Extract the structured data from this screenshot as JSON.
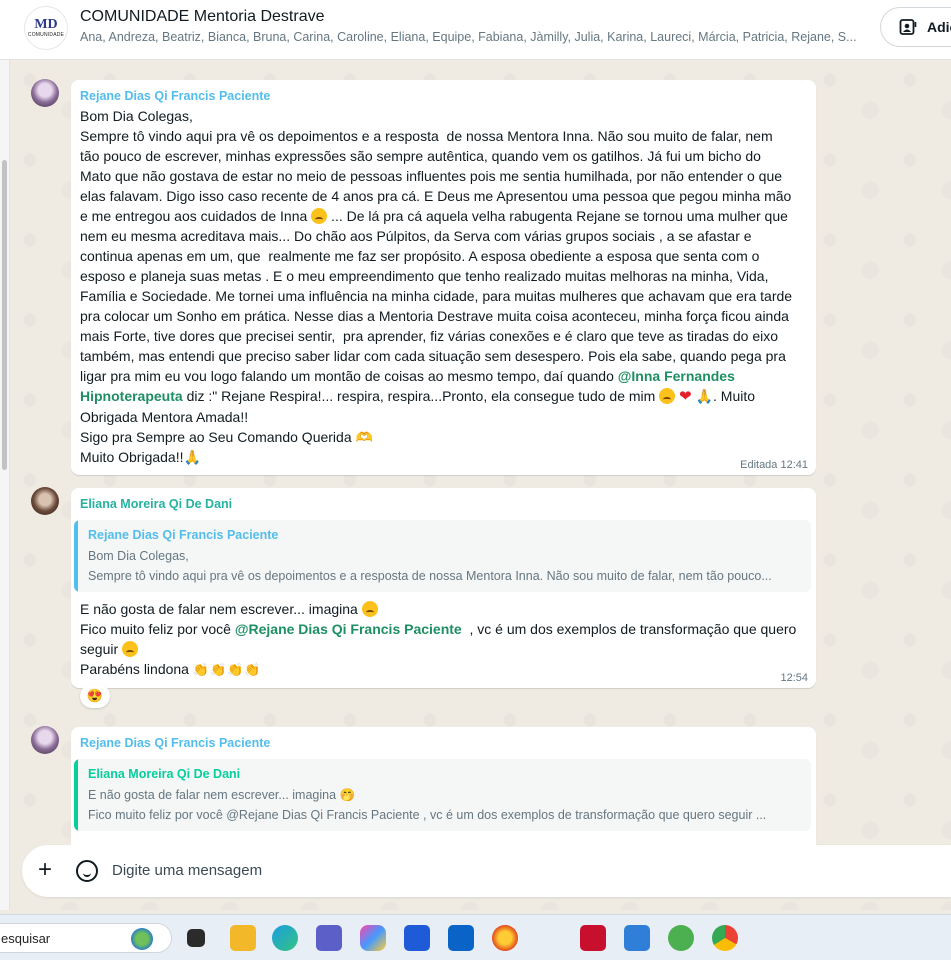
{
  "header": {
    "group_logo_mark": "MD",
    "group_logo_sub": "COMUNIDADE",
    "group_name": "COMUNIDADE Mentoria Destrave",
    "members": "Ana, Andreza, Beatriz, Bianca, Bruna, Carina, Caroline, Eliana, Equipe, Fabiana, Jàmilly, Julia, Karina, Laureci, Márcia, Patricia, Rejane, S...",
    "add_button_label": "Adic"
  },
  "messages": [
    {
      "sender": "Rejane Dias Qi Francis Paciente",
      "lines_before_mention": "Bom Dia Colegas,\nSempre tô vindo aqui pra vê os depoimentos e a resposta  de nossa Mentora Inna. Não sou muito de falar, nem\ntão pouco de escrever, minhas expressões são sempre autêntica, quando vem os gatilhos. Já fui um bicho do\nMato que não gostava de estar no meio de pessoas influentes pois me sentia humilhada, por não entender o que\nelas falavam. Digo isso caso recente de 4 anos pra cá. E Deus me Apresentou uma pessoa que pegou minha mão\ne me entregou aos cuidados de Inna ",
      "after_emoji_1": " ... De lá pra cá aquela velha rabugenta Rejane se tornou uma mulher que\nnem eu mesma acreditava mais... Do chão aos Púlpitos, da Serva com várias grupos sociais , a se afastar e\ncontinua apenas em um, que  realmente me faz ser propósito. A esposa obediente a esposa que senta com o\nesposo e planeja suas metas . E o meu empreendimento que tenho realizado muitas melhoras na minha, Vida,\nFamília e Sociedade. Me tornei uma influência na minha cidade, para muitas mulheres que achavam que era tarde\npra colocar um Sonho em prática. Nesse dias a Mentoria Destrave muita coisa aconteceu, minha força ficou ainda\nmais Forte, tive dores que precisei sentir,  pra aprender, fiz várias conexões e é claro que teve as tiradas do eixo\ntambém, mas entendi que preciso saber lidar com cada situação sem desespero. Pois ela sabe, quando pega pra\nligar pra mim eu vou logo falando um montão de coisas ao mesmo tempo, daí quando ",
      "mention": "@Inna Fernandes\nHipnoterapeuta",
      "after_mention": " diz :\" Rejane Respira!... respira, respira...Pronto, ela consegue tudo de mim ",
      "after_emojis_2": ". Muito\nObrigada Mentora Amada!!\nSigo pra Sempre ao Seu Comando Querida ",
      "last_line": "\nMuito Obrigada!!",
      "meta": "Editada 12:41"
    },
    {
      "sender": "Eliana Moreira Qi De Dani",
      "quote_sender": "Rejane Dias Qi Francis Paciente",
      "quote_line_1": "Bom Dia Colegas,",
      "quote_line_2": "Sempre tô vindo aqui pra vê os depoimentos e a resposta  de nossa Mentora Inna. Não sou muito de falar, nem tão pouco...",
      "line_1": "E não gosta de falar nem escrever... imagina ",
      "line_2_before": "Fico muito feliz por você ",
      "mention": "@Rejane Dias Qi Francis Paciente",
      "line_2_after": "  , vc é um dos exemplos de transformação que quero\nseguir ",
      "line_3": "Parabéns lindona ",
      "time": "12:54",
      "reaction": "😍"
    },
    {
      "sender": "Rejane Dias Qi Francis Paciente",
      "quote_sender": "Eliana Moreira Qi De Dani",
      "quote_line_1": "E não gosta de falar nem escrever... imagina 🤭",
      "quote_line_2": "Fico muito feliz por você @Rejane Dias Qi Francis Paciente  , vc é um dos exemplos de transformação que quero seguir ..."
    }
  ],
  "composer": {
    "placeholder": "Digite uma mensagem"
  },
  "taskbar": {
    "search_text": "esquisar"
  },
  "colors": {
    "chat_bg": "#efeae2",
    "sender_rejane": "#53bdeb",
    "sender_eliana": "#25b2a0",
    "mention": "#1e8e63"
  }
}
